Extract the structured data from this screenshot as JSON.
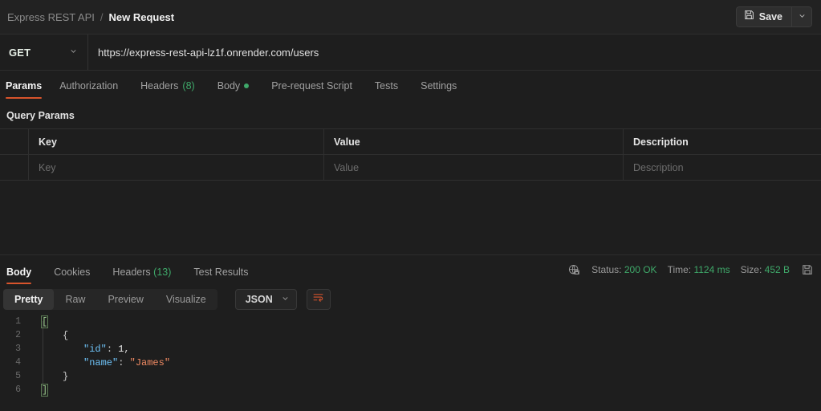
{
  "header": {
    "collection_name": "Express REST API",
    "separator": "/",
    "request_name": "New Request",
    "save_label": "Save",
    "save_icon": "floppy-disk-icon",
    "save_caret_icon": "chevron-down-icon"
  },
  "url_bar": {
    "method": "GET",
    "method_caret_icon": "chevron-down-icon",
    "url": "https://express-rest-api-lz1f.onrender.com/users"
  },
  "request_tabs": [
    {
      "label": "Params",
      "active": true,
      "count": "",
      "dot": false
    },
    {
      "label": "Authorization",
      "active": false,
      "count": "",
      "dot": false
    },
    {
      "label": "Headers",
      "active": false,
      "count": "(8)",
      "dot": false
    },
    {
      "label": "Body",
      "active": false,
      "count": "",
      "dot": true
    },
    {
      "label": "Pre-request Script",
      "active": false,
      "count": "",
      "dot": false
    },
    {
      "label": "Tests",
      "active": false,
      "count": "",
      "dot": false
    },
    {
      "label": "Settings",
      "active": false,
      "count": "",
      "dot": false
    }
  ],
  "query_params": {
    "title": "Query Params",
    "columns": [
      "Key",
      "Value",
      "Description"
    ],
    "rows": [
      {
        "key": "Key",
        "value": "Value",
        "description": "Description"
      }
    ]
  },
  "response": {
    "tabs": [
      {
        "label": "Body",
        "active": true,
        "count": ""
      },
      {
        "label": "Cookies",
        "active": false,
        "count": ""
      },
      {
        "label": "Headers",
        "active": false,
        "count": "(13)"
      },
      {
        "label": "Test Results",
        "active": false,
        "count": ""
      }
    ],
    "secure_icon": "globe-lock-icon",
    "meta": [
      {
        "label": "Status:",
        "value": "200 OK"
      },
      {
        "label": "Time:",
        "value": "1124 ms"
      },
      {
        "label": "Size:",
        "value": "452 B"
      }
    ],
    "save_response_icon": "floppy-disk-icon",
    "viewer": {
      "modes": [
        {
          "label": "Pretty",
          "active": true
        },
        {
          "label": "Raw",
          "active": false
        },
        {
          "label": "Preview",
          "active": false
        },
        {
          "label": "Visualize",
          "active": false
        }
      ],
      "format": "JSON",
      "format_caret_icon": "chevron-down-icon",
      "wrap_icon": "wrap-lines-icon"
    },
    "code": {
      "lines": [
        {
          "no": "1",
          "indent": 0,
          "tokens": [
            {
              "t": "[",
              "c": "brk"
            }
          ]
        },
        {
          "no": "2",
          "indent": 1,
          "tokens": [
            {
              "t": "{",
              "c": "tok-punct"
            }
          ]
        },
        {
          "no": "3",
          "indent": 2,
          "tokens": [
            {
              "t": "\"id\"",
              "c": "tok-key"
            },
            {
              "t": ": ",
              "c": "tok-punct"
            },
            {
              "t": "1",
              "c": "tok-num"
            },
            {
              "t": ",",
              "c": "tok-punct"
            }
          ]
        },
        {
          "no": "4",
          "indent": 2,
          "tokens": [
            {
              "t": "\"name\"",
              "c": "tok-key"
            },
            {
              "t": ": ",
              "c": "tok-punct"
            },
            {
              "t": "\"James\"",
              "c": "tok-str"
            }
          ]
        },
        {
          "no": "5",
          "indent": 1,
          "tokens": [
            {
              "t": "}",
              "c": "tok-punct"
            }
          ]
        },
        {
          "no": "6",
          "indent": 0,
          "tokens": [
            {
              "t": "]",
              "c": "brk"
            }
          ]
        }
      ]
    }
  },
  "colors": {
    "accent_orange": "#d8542c",
    "success_green": "#3fa96a",
    "background": "#1e1e1e",
    "panel": "#222222",
    "json_key": "#6ec2f7",
    "json_string": "#f08a63"
  }
}
